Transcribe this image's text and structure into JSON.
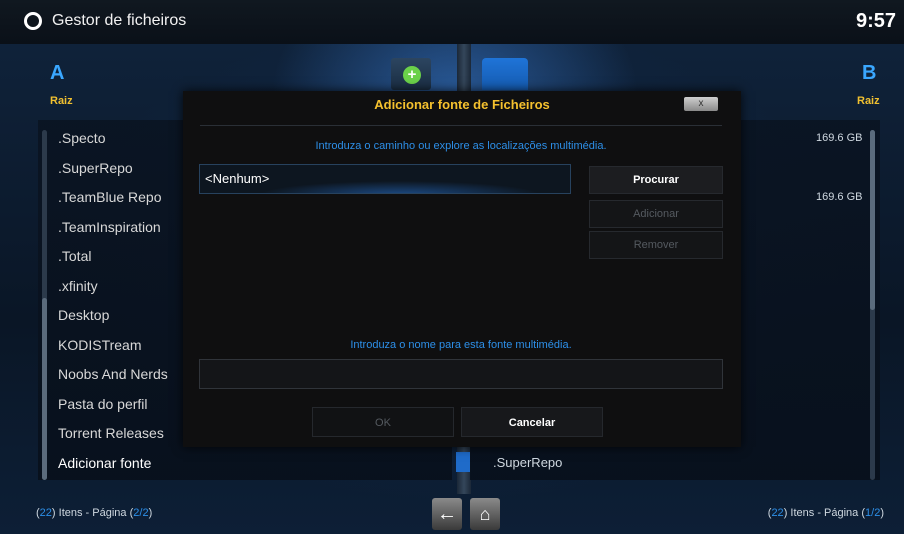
{
  "header": {
    "title": "Gestor de ficheiros",
    "clock": "9:57",
    "logo_icon": "kodi-logo-icon"
  },
  "left_pane": {
    "letter": "A",
    "root": "Raiz",
    "items": [
      ".Specto",
      ".SuperRepo",
      ".TeamBlue Repo",
      ".TeamInspiration",
      ".Total",
      ".xfinity",
      "Desktop",
      "KODISTream",
      "Noobs And Nerds",
      "Pasta do perfil",
      "Torrent Releases",
      "Adicionar fonte"
    ],
    "selected": "Adicionar fonte",
    "footer": {
      "count": "22",
      "count_label": "Itens - Página",
      "page": "2/2"
    }
  },
  "right_pane": {
    "letter": "B",
    "root": "Raiz",
    "sizes": [
      "169.6 GB",
      "169.6 GB"
    ],
    "visible_item": ".SuperRepo",
    "footer": {
      "count": "22",
      "count_label": "Itens - Página",
      "page": "1/2"
    }
  },
  "dialog": {
    "title": "Adicionar fonte de Ficheiros",
    "close_label": "x",
    "path_hint": "Introduza o caminho ou explore as localizações multimédia.",
    "path_value": "<Nenhum>",
    "buttons": {
      "browse": "Procurar",
      "add": "Adicionar",
      "remove": "Remover"
    },
    "name_hint": "Introduza o nome para esta fonte multimédia.",
    "name_value": "",
    "ok": "OK",
    "cancel": "Cancelar"
  },
  "nav": {
    "back_icon": "back-arrow-icon",
    "home_icon": "home-icon"
  },
  "colors": {
    "accent_blue": "#2d8fe8",
    "title_gold": "#f5c12e",
    "letter_blue": "#3aa7ff"
  }
}
